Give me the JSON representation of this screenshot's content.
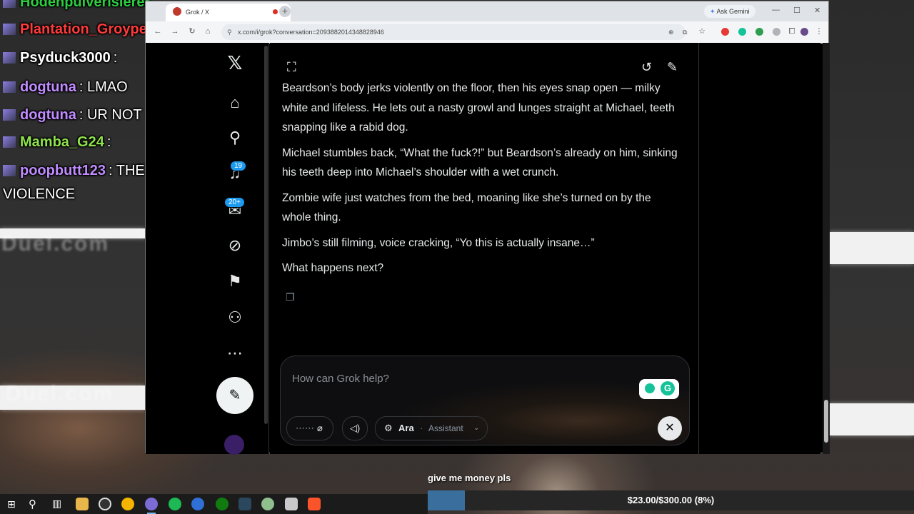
{
  "chat": {
    "lines": [
      {
        "user": "Hodenpulverisierer",
        "message": "",
        "color": "#2ecc40"
      },
      {
        "user": "Plantation_Groyper",
        "message": ":",
        "color": "#ff3b3b"
      },
      {
        "user": "Psyduck3000",
        "message": ":",
        "color": "#ffffff"
      },
      {
        "user": "dogtuna",
        "message": ": LMAO",
        "color": "#c08cff"
      },
      {
        "user": "dogtuna",
        "message": ": UR NOT PLAYING FAIR",
        "color": "#c08cff"
      },
      {
        "user": "Mamba_G24",
        "message": ":",
        "color": "#8fe34b"
      },
      {
        "user": "poopbutt123",
        "message": ": THE KING OF",
        "message_cont": "VIOLENCE",
        "color": "#c08cff"
      }
    ]
  },
  "browser": {
    "tab_title": "Grok / X",
    "ask_gemini": "Ask Gemini",
    "url": "x.com/i/grok?conversation=2093882014348828946"
  },
  "sidebar": {
    "notifications_badge": "19",
    "messages_badge": "20+"
  },
  "grok": {
    "paragraphs": [
      "Beardson’s body jerks violently on the floor, then his eyes snap open — milky white and lifeless. He lets out a nasty growl and lunges straight at Michael, teeth snapping like a rabid dog.",
      "Michael stumbles back, “What the fuck?!” but Beardson’s already on him, sinking his teeth deep into Michael’s shoulder with a wet crunch.",
      "Zombie wife just watches from the bed, moaning like she’s turned on by the whole thing.",
      "Jimbo’s still filming, voice cracking, “Yo this is actually insane…”",
      "What happens next?"
    ],
    "composer": {
      "placeholder": "How can Grok help?",
      "model_name": "Ara",
      "model_role": "Assistant"
    }
  },
  "stream": {
    "donate_label": "give me money pls",
    "progress_text": "$23.00/$300.00 (8%)",
    "progress_fraction": 0.0767
  }
}
